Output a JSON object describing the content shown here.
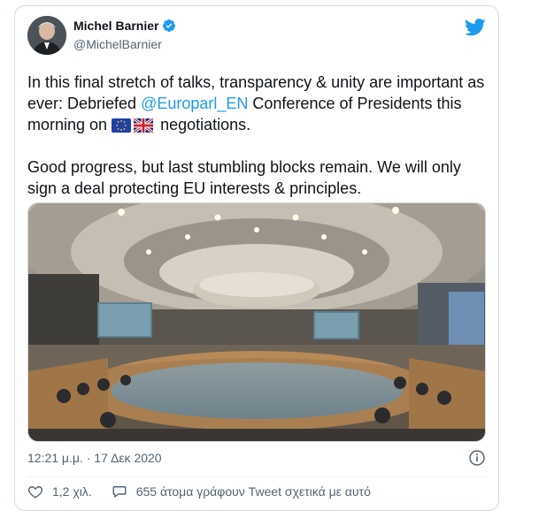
{
  "tweet": {
    "author_name": "Michel Barnier",
    "author_handle": "@MichelBarnier",
    "text_p1_a": "In this final stretch of talks, transparency & unity are important as ever: Debriefed ",
    "mention": "@Europarl_EN",
    "text_p1_b": " Conference of Presidents this morning on ",
    "text_p1_c": " negotiations.",
    "text_p2": "Good progress, but last stumbling blocks remain. We will only sign a deal protecting EU interests & principles.",
    "timestamp": "12:21 μ.μ. · 17 Δεκ 2020",
    "likes": "1,2 χιλ.",
    "talking": "655 άτομα γράφουν Tweet σχετικά με αυτό"
  },
  "icons": {
    "verified": "verified-badge-icon",
    "twitter": "twitter-bird-icon",
    "info": "info-icon",
    "like": "heart-icon",
    "reply": "speech-bubble-icon",
    "flag_eu": "eu-flag-icon",
    "flag_uk": "uk-flag-icon"
  },
  "colors": {
    "accent": "#1d9bf0",
    "muted": "#536471",
    "border": "#cfd9de"
  }
}
